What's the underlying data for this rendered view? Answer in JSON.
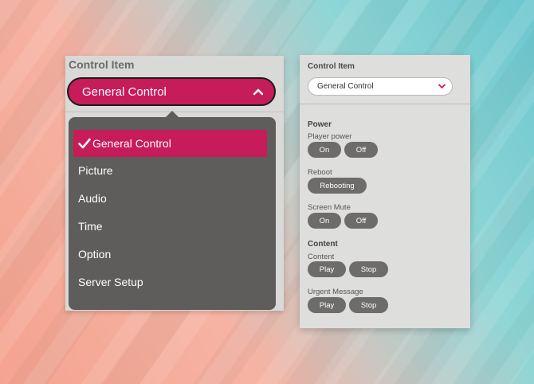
{
  "zoom_panel": {
    "title": "Control Item",
    "selected_value": "General Control",
    "dropdown_options": [
      {
        "label": "General Control",
        "selected": true
      },
      {
        "label": "Picture",
        "selected": false
      },
      {
        "label": "Audio",
        "selected": false
      },
      {
        "label": "Time",
        "selected": false
      },
      {
        "label": "Option",
        "selected": false
      },
      {
        "label": "Server Setup",
        "selected": false
      }
    ]
  },
  "panel": {
    "title": "Control Item",
    "selected_value": "General Control",
    "sections": [
      {
        "title": "Power",
        "controls": [
          {
            "label": "Player power",
            "buttons": [
              "On",
              "Off"
            ]
          },
          {
            "label": "Reboot",
            "buttons": [
              "Rebooting"
            ]
          },
          {
            "label": "Screen Mute",
            "buttons": [
              "On",
              "Off"
            ]
          }
        ]
      },
      {
        "title": "Content",
        "controls": [
          {
            "label": "Content",
            "buttons": [
              "Play",
              "Stop"
            ]
          },
          {
            "label": "Urgent Message",
            "buttons": [
              "Play",
              "Stop"
            ]
          }
        ]
      }
    ]
  },
  "colors": {
    "accent": "#c61c5a",
    "button_bg": "#6d6c6a",
    "dropdown_bg": "#5e5d5b"
  },
  "icons": {
    "zoom_select": "chevron-up-icon",
    "selected_option": "check-icon",
    "panel_select": "chevron-down-icon"
  }
}
